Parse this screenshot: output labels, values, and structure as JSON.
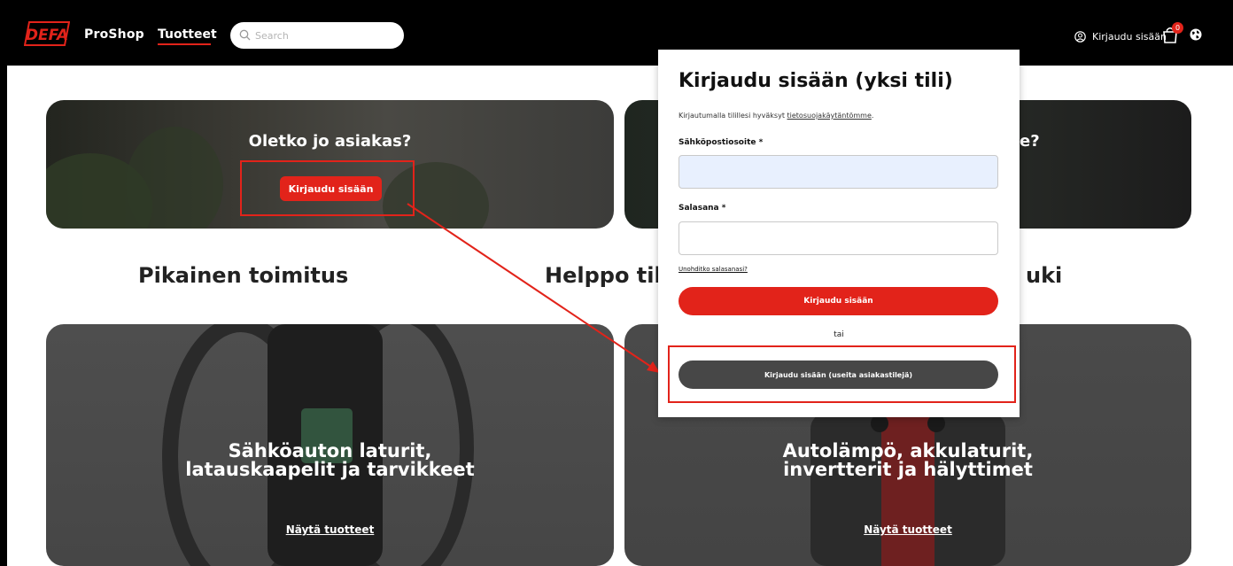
{
  "header": {
    "logo_text": "DEFA",
    "brand": "ProShop",
    "nav_products": "Tuotteet",
    "search_placeholder": "Search",
    "login_label": "Kirjaudu sisään",
    "cart_count": "0"
  },
  "hero": {
    "left": {
      "title": "Oletko jo asiakas?",
      "button": "Kirjaudu sisään"
    },
    "right": {
      "title_visible": "e?"
    }
  },
  "features": {
    "left": "Pikainen toimitus",
    "middle_visible": "Helppo til",
    "right_visible": "uki"
  },
  "categories": [
    {
      "title_line1": "Sähköauton laturit,",
      "title_line2": "latauskaapelit ja tarvikkeet",
      "link": "Näytä tuotteet"
    },
    {
      "title_line1": "Autolämpö, akkulaturit,",
      "title_line2": "invertterit ja hälyttimet",
      "link": "Näytä tuotteet"
    }
  ],
  "modal": {
    "title": "Kirjaudu sisään (yksi tili)",
    "consent_prefix": "Kirjautumalla tilillesi hyväksyt ",
    "consent_link": "tietosuojakäytäntömme",
    "consent_suffix": ".",
    "email_label": "Sähköpostiosoite *",
    "password_label": "Salasana *",
    "forgot": "Unohditko salasanasi?",
    "login_button": "Kirjaudu sisään",
    "or": "tai",
    "multi_button": "Kirjaudu sisään (useita asiakastilejä)"
  },
  "colors": {
    "brand_red": "#e2231a",
    "dark_button": "#474747",
    "header_bg": "#000000"
  },
  "icons": {
    "search": "search-icon",
    "user": "user-circle-icon",
    "cart": "shopping-bag-icon",
    "globe": "globe-icon"
  }
}
